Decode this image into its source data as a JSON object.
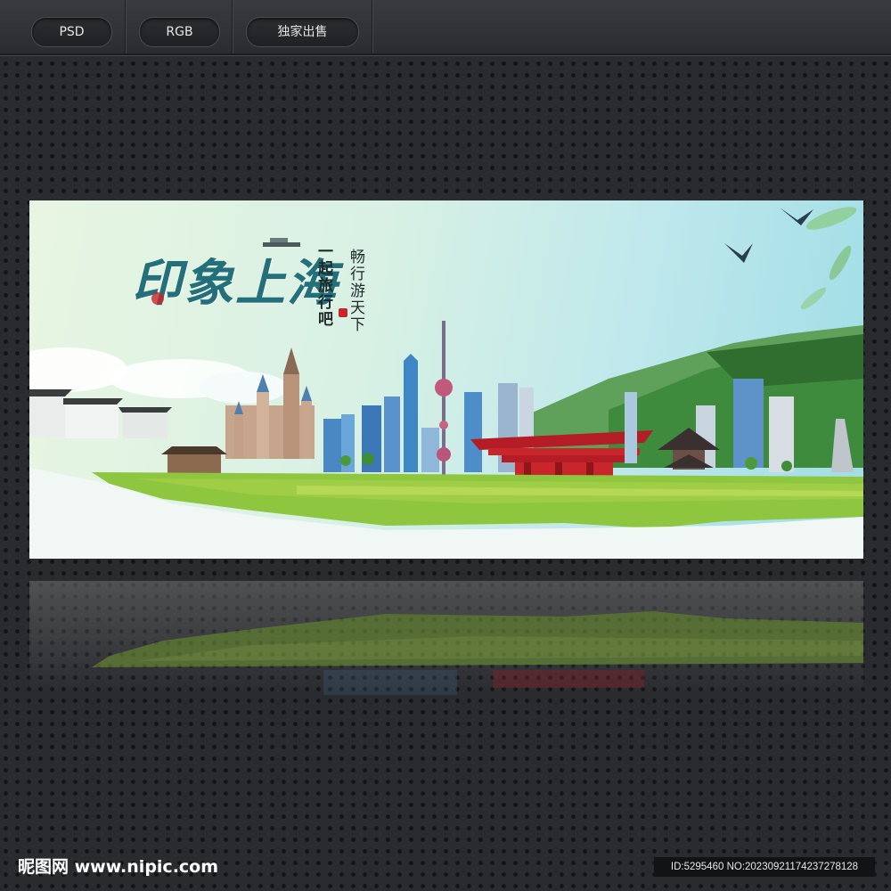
{
  "toolbar": {
    "badges": [
      "PSD",
      "RGB",
      "独家出售"
    ]
  },
  "banner": {
    "title": "印象上海",
    "tagline_1": "一起旅行吧",
    "tagline_2": "畅行游天下"
  },
  "footer": {
    "logo": "昵图网 www.nipic.com",
    "id_text": "ID:5295460 NO:20230921174237278128"
  },
  "colors": {
    "accent_red": "#c8262a",
    "title_teal": "#236f7a",
    "grass_green": "#8ec63f"
  }
}
